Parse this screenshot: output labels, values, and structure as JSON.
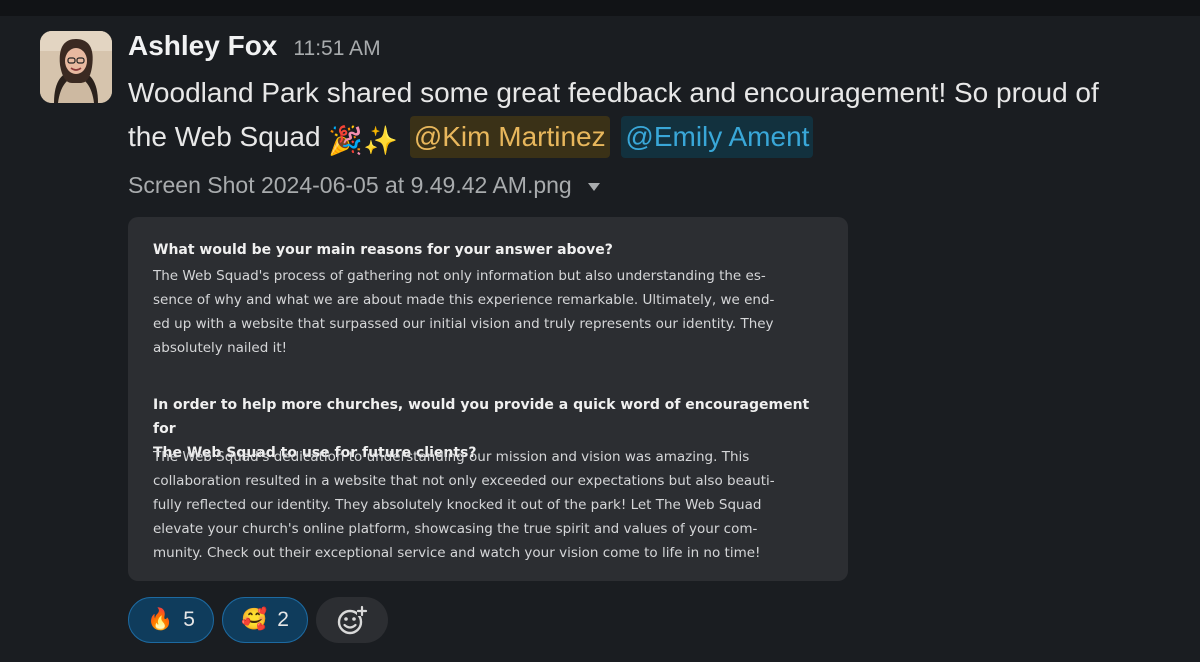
{
  "message": {
    "sender": "Ashley Fox",
    "time": "11:51 AM",
    "text_line1": "Woodland Park shared some great feedback and encouragement! So proud of",
    "text_line2_prefix": "the Web Squad",
    "emoji_party": "🎉",
    "emoji_sparkles": "✨",
    "mention1": "@Kim Martinez",
    "mention2": "@Emily Ament"
  },
  "attachment": {
    "filename": "Screen Shot 2024-06-05 at 9.49.42 AM.png"
  },
  "card": {
    "q1": "What would be your main reasons for your answer above?",
    "a1_lines": [
      "The Web Squad's process of gathering not only information but also understanding the es-",
      "sence of why and what we are about made this experience remarkable. Ultimately, we end-",
      "ed up with a website that surpassed our initial vision and truly represents our identity. They",
      "absolutely nailed it!"
    ],
    "q2_lines": [
      "In order to help more churches, would you provide a quick word of encouragement for",
      "The Web Squad to use for future clients?"
    ],
    "a2_lines": [
      "The Web Squad's dedication to understanding our mission and vision was amazing. This",
      "collaboration resulted in a website that not only exceeded our expectations but also beauti-",
      "fully reflected our identity. They absolutely knocked it out of the park! Let The Web Squad",
      "elevate your church's online platform, showcasing the true spirit and values of your com-",
      "munity. Check out their exceptional service and watch your vision come to life in no time!"
    ]
  },
  "reactions": [
    {
      "emoji": "🔥",
      "count": "5",
      "icon": "fire-icon"
    },
    {
      "emoji": "🥰",
      "count": "2",
      "icon": "smiling-face-hearts-icon"
    }
  ],
  "add_reaction_icon": "add-reaction-icon",
  "colors": {
    "background": "#1a1d21",
    "card": "#2c2e32",
    "mention_yellow_bg": "#3a3117",
    "mention_yellow_fg": "#e8b75c",
    "mention_blue_bg": "#12313e",
    "mention_blue_fg": "#39a7d8",
    "reaction_active_bg": "#0f3c5c",
    "reaction_active_border": "#1d6aa1"
  }
}
